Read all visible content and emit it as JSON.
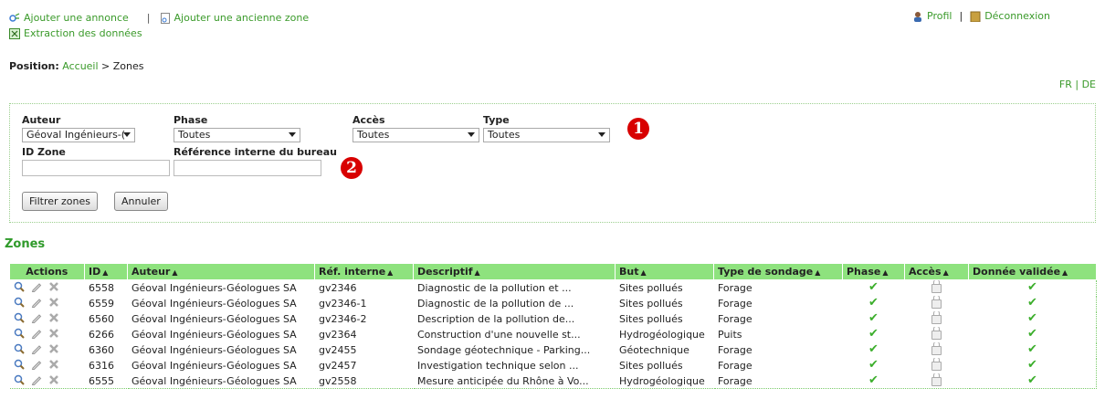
{
  "nav": {
    "add_announcement": "Ajouter une annonce",
    "add_old_zone": "Ajouter une ancienne zone",
    "extraction": "Extraction des données",
    "profile": "Profil",
    "logout": "Déconnexion",
    "separator": "|"
  },
  "breadcrumb": {
    "label": "Position:",
    "home": "Accueil",
    "sep": ">",
    "current": "Zones"
  },
  "lang": {
    "fr": "FR",
    "sep": "|",
    "de": "DE"
  },
  "filters": {
    "author_label": "Auteur",
    "author_value": "Géoval Ingénieurs-(",
    "phase_label": "Phase",
    "phase_value": "Toutes",
    "access_label": "Accès",
    "access_value": "Toutes",
    "type_label": "Type",
    "type_value": "Toutes",
    "id_label": "ID Zone",
    "ref_label": "Référence interne du bureau",
    "filter_button": "Filtrer zones",
    "cancel_button": "Annuler",
    "badge1": "1",
    "badge2": "2"
  },
  "zones_title": "Zones",
  "table": {
    "headers": {
      "actions": "Actions",
      "id": "ID",
      "author": "Auteur",
      "ref": "Réf. interne",
      "desc": "Descriptif",
      "goal": "But",
      "type": "Type de sondage",
      "phase": "Phase",
      "access": "Accès",
      "validated": "Donnée validée",
      "sort_arrow": "▲"
    },
    "rows": [
      {
        "id": "6558",
        "author": "Géoval Ingénieurs-Géologues SA",
        "ref": "gv2346",
        "desc": "Diagnostic de la pollution et ...",
        "goal": "Sites pollués",
        "type": "Forage"
      },
      {
        "id": "6559",
        "author": "Géoval Ingénieurs-Géologues SA",
        "ref": "gv2346-1",
        "desc": "Diagnostic de la pollution de ...",
        "goal": "Sites pollués",
        "type": "Forage"
      },
      {
        "id": "6560",
        "author": "Géoval Ingénieurs-Géologues SA",
        "ref": "gv2346-2",
        "desc": "Description de la pollution de...",
        "goal": "Sites pollués",
        "type": "Forage"
      },
      {
        "id": "6266",
        "author": "Géoval Ingénieurs-Géologues SA",
        "ref": "gv2364",
        "desc": "Construction d'une nouvelle st...",
        "goal": "Hydrogéologique",
        "type": "Puits"
      },
      {
        "id": "6360",
        "author": "Géoval Ingénieurs-Géologues SA",
        "ref": "gv2455",
        "desc": "Sondage géotechnique - Parking...",
        "goal": "Géotechnique",
        "type": "Forage"
      },
      {
        "id": "6316",
        "author": "Géoval Ingénieurs-Géologues SA",
        "ref": "gv2457",
        "desc": "Investigation technique selon ...",
        "goal": "Sites pollués",
        "type": "Forage"
      },
      {
        "id": "6555",
        "author": "Géoval Ingénieurs-Géologues SA",
        "ref": "gv2558",
        "desc": "Mesure anticipée du Rhône à Vo...",
        "goal": "Hydrogéologique",
        "type": "Forage"
      }
    ]
  },
  "colors": {
    "accent": "#3a9a2a",
    "header_bg": "#8ee27e",
    "badge": "#d80000"
  }
}
